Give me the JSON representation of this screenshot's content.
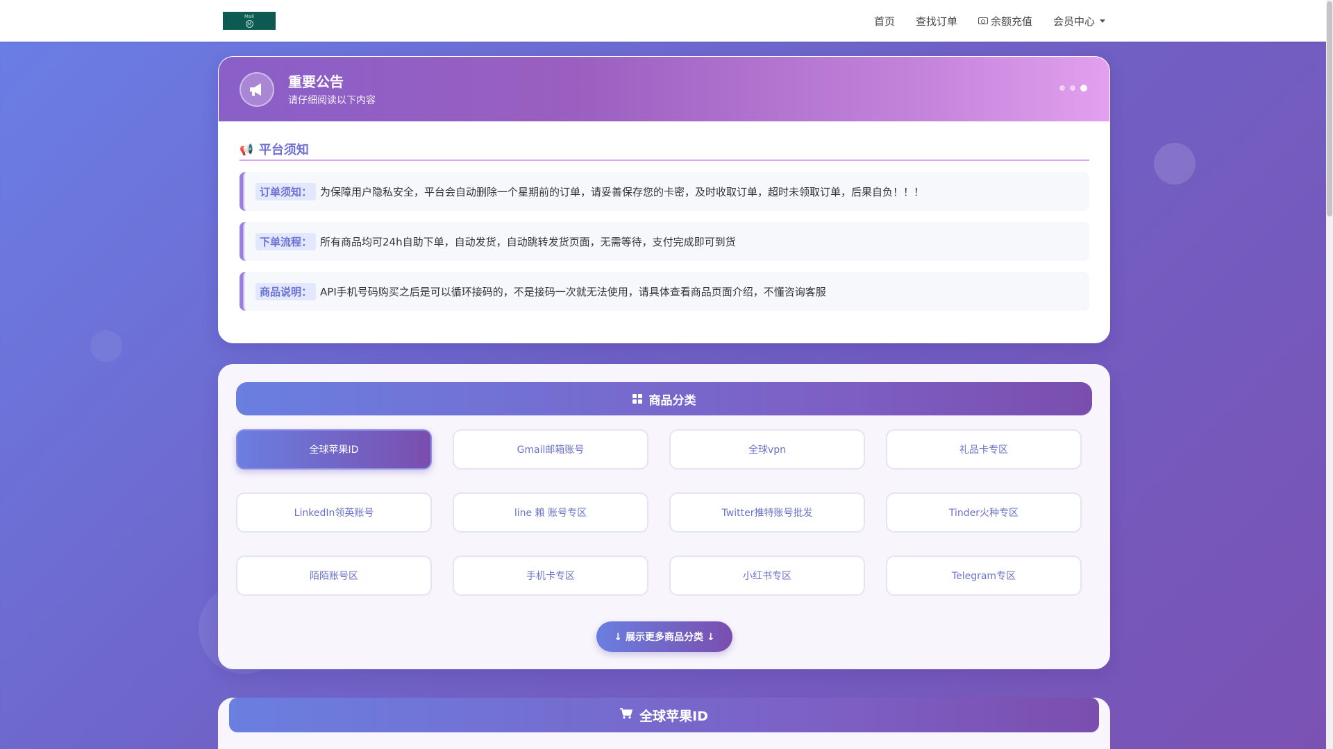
{
  "navbar": {
    "logo_top": "Mall",
    "logo_letter": "M",
    "links": [
      {
        "label": "首页"
      },
      {
        "label": "查找订单"
      },
      {
        "label": "余额充值",
        "icon": "wallet-icon"
      },
      {
        "label": "会员中心",
        "icon": "chevron-down-icon"
      }
    ]
  },
  "notice": {
    "title": "重要公告",
    "subtitle": "请仔细阅读以下内容",
    "section_icon": "📢",
    "section_title": "平台须知",
    "items": [
      {
        "label": "订单须知：",
        "text": "为保障用户隐私安全，平台会自动删除一个星期前的订单，请妥善保存您的卡密，及时收取订单，超时未领取订单，后果自负！！！"
      },
      {
        "label": "下单流程：",
        "text": "所有商品均可24h自助下单，自动发货，自动跳转发货页面，无需等待，支付完成即可到货"
      },
      {
        "label": "商品说明：",
        "text": "API手机号码购买之后是可以循环接码的，不是接码一次就无法使用，请具体查看商品页面介绍，不懂咨询客服"
      }
    ]
  },
  "categories": {
    "title": "商品分类",
    "items": [
      "全球苹果ID",
      "Gmail邮箱账号",
      "全球vpn",
      "礼品卡专区",
      "LinkedIn领英账号",
      "line 賴 账号专区",
      "Twitter推特账号批发",
      "Tinder火种专区",
      "陌陌账号区",
      "手机卡专区",
      "小红书专区",
      "Telegram专区"
    ],
    "active_index": 0,
    "more_label": "↓ 展示更多商品分类 ↓"
  },
  "product_section": {
    "title": "全球苹果ID",
    "icon": "cart-icon"
  },
  "colors": {
    "accent": "#6a7fe0",
    "accent_end": "#7a4eae",
    "label_text": "#6a72d2"
  }
}
